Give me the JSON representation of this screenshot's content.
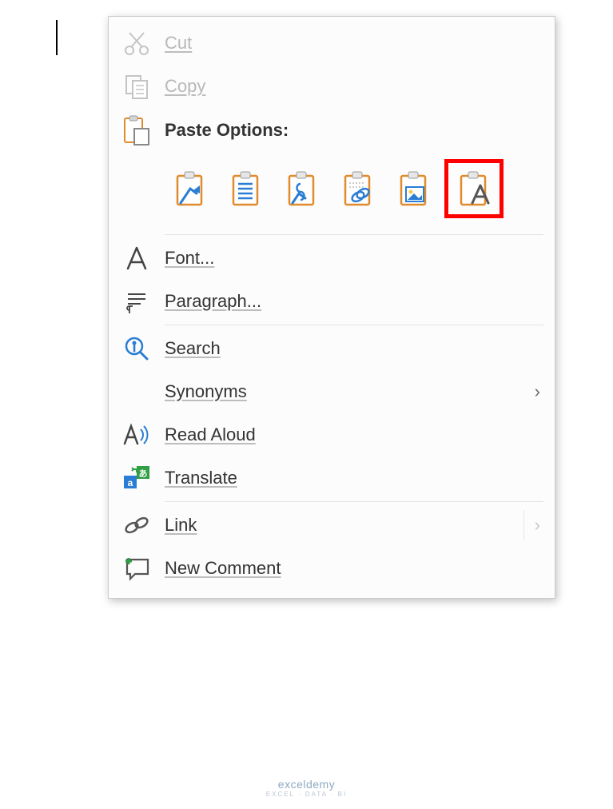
{
  "menu": {
    "cut": "Cut",
    "copy": "Copy",
    "paste_options": "Paste Options:",
    "paste_buttons": [
      "keep-source-formatting",
      "merge-formatting",
      "use-destination-styles",
      "link-and-keep-source",
      "picture",
      "keep-text-only"
    ],
    "font": "Font...",
    "paragraph": "Paragraph...",
    "search": "Search",
    "synonyms": "Synonyms",
    "read_aloud": "Read Aloud",
    "translate": "Translate",
    "link": "Link",
    "new_comment": "New Comment"
  },
  "watermark": {
    "name": "exceldemy",
    "sub": "EXCEL · DATA · BI"
  }
}
